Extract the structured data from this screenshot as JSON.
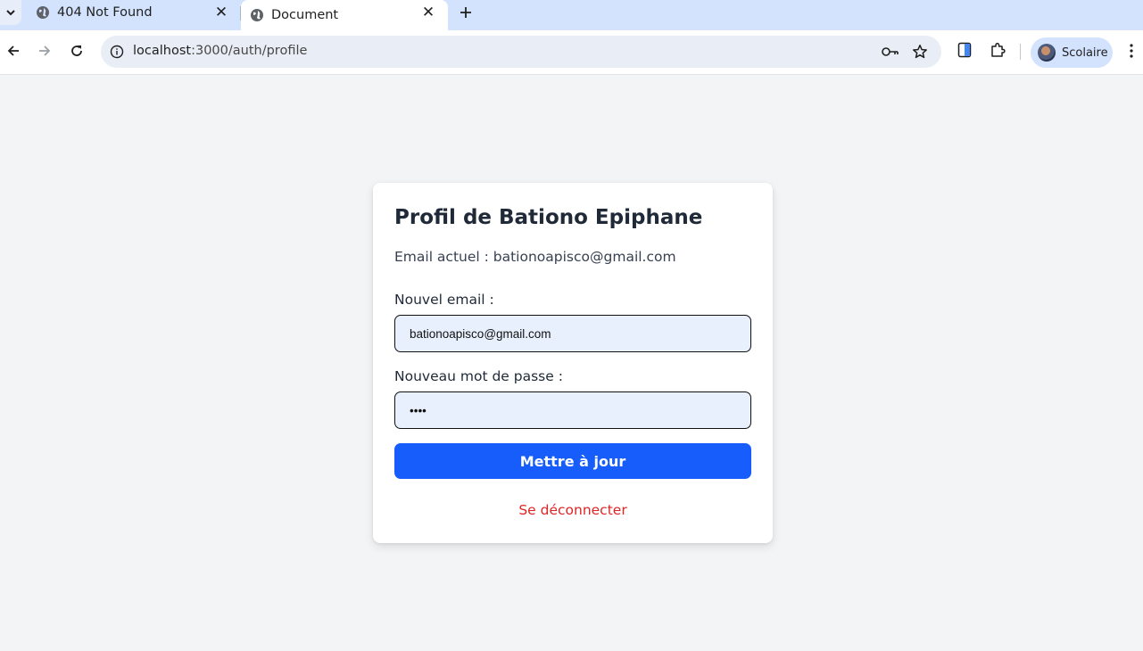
{
  "browser": {
    "tabs": [
      {
        "title": "404 Not Found",
        "active": false
      },
      {
        "title": "Document",
        "active": true
      }
    ],
    "url_host": "localhost",
    "url_path": ":3000/auth/profile",
    "profile_name": "Scolaire",
    "icons": [
      "tab-list-icon",
      "globe-icon",
      "close-icon",
      "plus-icon",
      "back-arrow-icon",
      "forward-arrow-icon",
      "reload-icon",
      "info-icon",
      "key-icon",
      "star-icon",
      "side-panel-icon",
      "extensions-icon",
      "more-vert-icon"
    ]
  },
  "profile": {
    "title": "Profil de Bationo Epiphane",
    "current_email_text": "Email actuel : bationoapisco@gmail.com",
    "email_label": "Nouvel email :",
    "email_value": "bationoapisco@gmail.com",
    "password_label": "Nouveau mot de passe :",
    "password_value": "test",
    "submit_label": "Mettre à jour",
    "logout_label": "Se déconnecter"
  },
  "colors": {
    "primary": "#165dfb",
    "danger": "#dc2626",
    "page_bg": "#f3f4f6",
    "input_bg": "#e8f0fe"
  }
}
